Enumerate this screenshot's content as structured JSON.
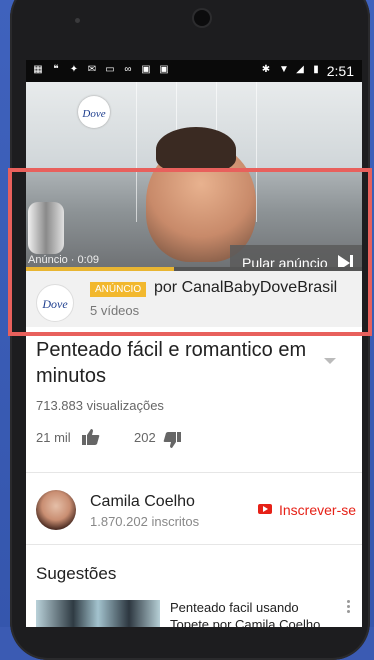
{
  "status_bar": {
    "time": "2:51",
    "icons": [
      "calendar-icon",
      "hangouts-icon",
      "twitter-icon",
      "gmail-icon",
      "image-icon",
      "voicemail-icon",
      "bag-icon",
      "bag-check-icon",
      "bluetooth-icon",
      "wifi-icon",
      "signal-icon",
      "battery-icon"
    ]
  },
  "ad": {
    "skip_label": "Pular anúncio",
    "time_label": "Anúncio · 0:09",
    "progress": 0.44,
    "badge": "ANÚNCIO",
    "channel": "por CanalBabyDoveBrasil",
    "videos": "5 vídeos",
    "logo_text": "Dove",
    "video_logo_text": "Dove"
  },
  "video": {
    "title": "Penteado fácil e romantico em minutos",
    "views": "713.883 visualizações",
    "likes": "21 mil",
    "dislikes": "202"
  },
  "channel": {
    "name": "Camila Coelho",
    "subscribers": "1.870.202 inscritos",
    "subscribe_label": "Inscrever-se"
  },
  "suggestions": {
    "header": "Sugestões",
    "items": [
      {
        "title": "Penteado facil usando Topete por Camila Coelho"
      }
    ]
  },
  "colors": {
    "accent_red": "#e62117",
    "ad_yellow": "#f2b82e",
    "highlight": "#e8605c"
  }
}
